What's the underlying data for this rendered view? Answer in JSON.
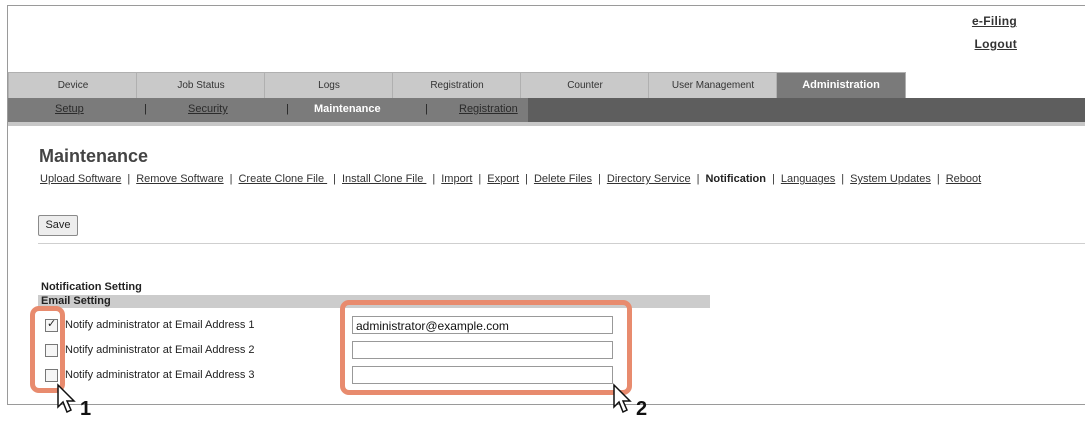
{
  "header": {
    "efiling_label": "e-Filing",
    "logout_label": "Logout"
  },
  "tabs": [
    {
      "label": "Device"
    },
    {
      "label": "Job Status"
    },
    {
      "label": "Logs"
    },
    {
      "label": "Registration"
    },
    {
      "label": "Counter"
    },
    {
      "label": "User Management"
    },
    {
      "label": "Administration",
      "active": true
    }
  ],
  "subnav": {
    "items": [
      {
        "label": "Setup"
      },
      {
        "label": "Security"
      },
      {
        "label": "Maintenance",
        "current": true
      },
      {
        "label": "Registration"
      }
    ],
    "separator": "|"
  },
  "page_title": "Maintenance",
  "menu": {
    "items": [
      {
        "label": "Upload Software"
      },
      {
        "label": "Remove Software"
      },
      {
        "label": "Create Clone File "
      },
      {
        "label": "Install Clone File "
      },
      {
        "label": "Import"
      },
      {
        "label": "Export"
      },
      {
        "label": "Delete Files"
      },
      {
        "label": "Directory Service"
      },
      {
        "label": "Notification",
        "current": true
      },
      {
        "label": "Languages"
      },
      {
        "label": "System Updates"
      },
      {
        "label": "Reboot"
      }
    ]
  },
  "toolbar": {
    "save_label": "Save"
  },
  "section": {
    "title": "Notification Setting",
    "subsection": "Email Setting",
    "rows": [
      {
        "label": "Notify administrator at Email Address 1",
        "checked": true,
        "value": "administrator@example.com"
      },
      {
        "label": "Notify administrator at Email Address 2",
        "checked": false,
        "value": ""
      },
      {
        "label": "Notify administrator at Email Address 3",
        "checked": false,
        "value": ""
      }
    ]
  },
  "callouts": [
    {
      "number": "1"
    },
    {
      "number": "2"
    }
  ],
  "colors": {
    "highlight": "#e88b6e",
    "active_tab": "#7a7a7a",
    "subnav": "#7b7b7b"
  }
}
